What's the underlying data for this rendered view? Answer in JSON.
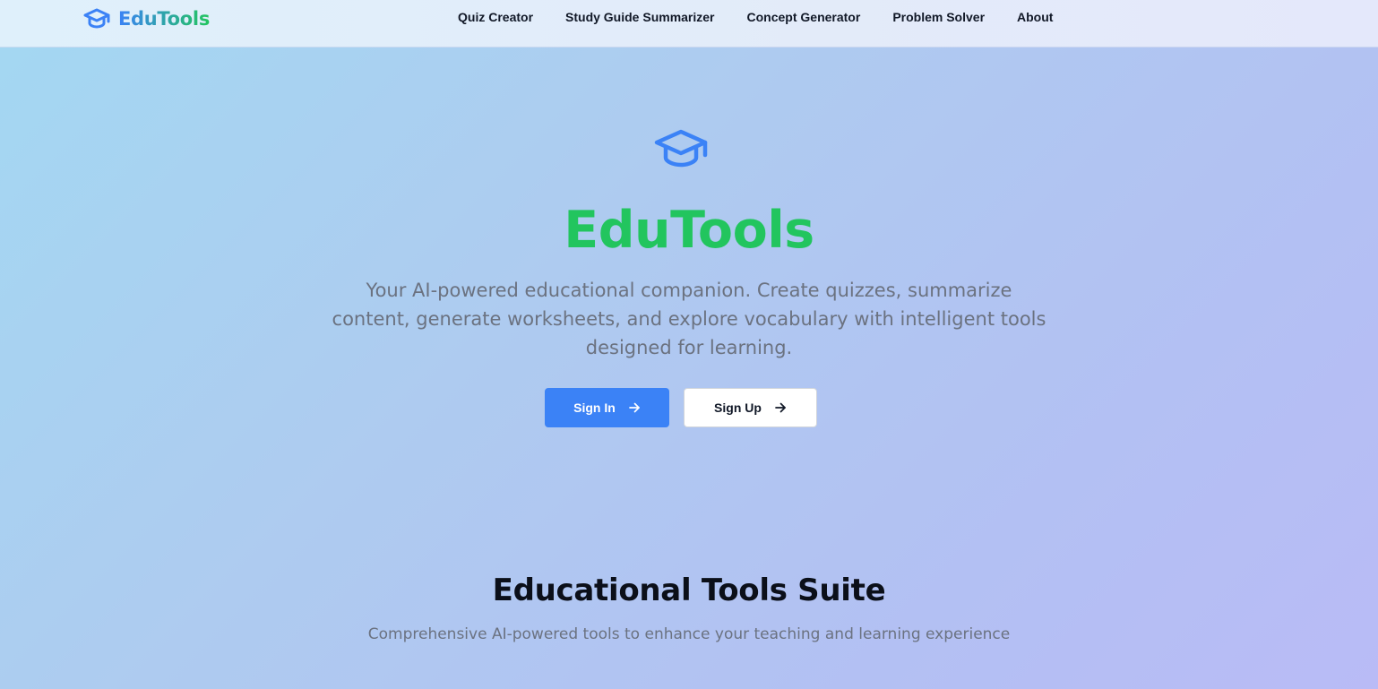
{
  "colors": {
    "primary": "#3b82f6",
    "brand_green": "#22c55e",
    "text_dark": "#111827",
    "text_muted": "#6b7280"
  },
  "navbar": {
    "brand_name": "EduTools",
    "brand_icon": "graduation-cap-icon",
    "links": [
      "Quiz Creator",
      "Study Guide Summarizer",
      "Concept Generator",
      "Problem Solver",
      "About"
    ]
  },
  "hero": {
    "icon": "graduation-cap-icon",
    "title": "EduTools",
    "subtitle": "Your AI-powered educational companion. Create quizzes, summarize content, generate worksheets, and explore vocabulary with intelligent tools designed for learning.",
    "signin_label": "Sign In",
    "signup_label": "Sign Up",
    "button_icon": "arrow-right-icon"
  },
  "tools_section": {
    "title": "Educational Tools Suite",
    "subtitle": "Comprehensive AI-powered tools to enhance your teaching and learning experience"
  }
}
